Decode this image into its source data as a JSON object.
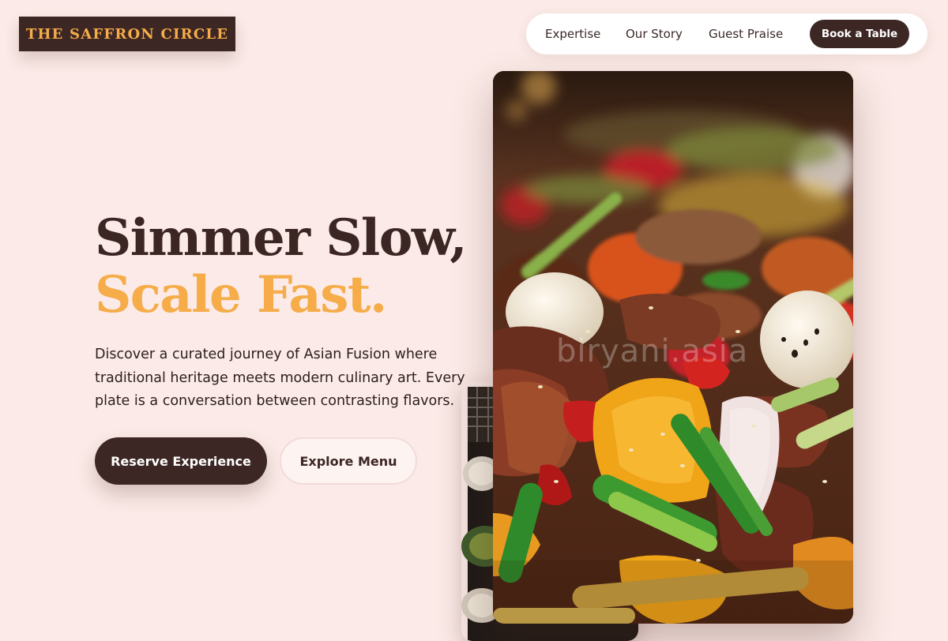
{
  "brand": {
    "name": "THE SAFFRON CIRCLE"
  },
  "nav": {
    "links": [
      "Expertise",
      "Our Story",
      "Guest Praise"
    ],
    "cta": "Book a Table"
  },
  "hero": {
    "headline_line1": "Simmer Slow,",
    "headline_line2": "Scale Fast.",
    "description": "Discover a curated journey of Asian Fusion where traditional heritage meets modern culinary art. Every plate is a conversation between contrasting flavors.",
    "primary_button": "Reserve Experience",
    "secondary_button": "Explore Menu"
  },
  "images": {
    "main_watermark": "biryani.asia"
  },
  "colors": {
    "background": "#fbeae7",
    "brand_dark": "#3d2724",
    "accent": "#f5ac49",
    "nav_background": "#ffffff"
  }
}
